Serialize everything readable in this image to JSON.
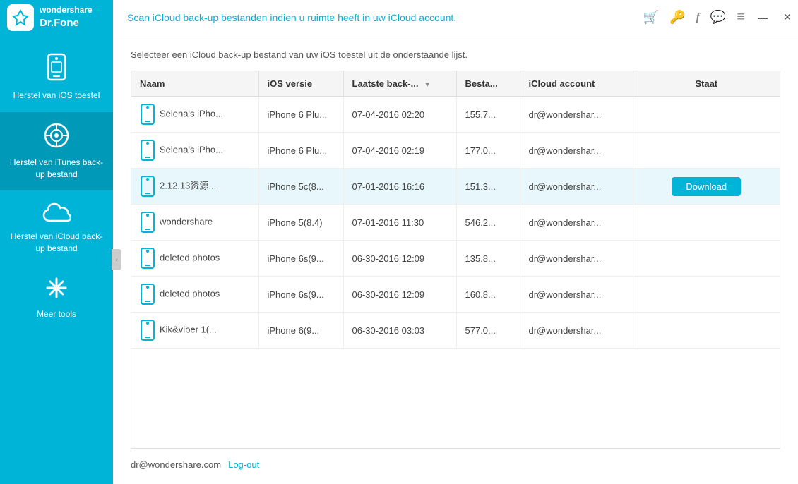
{
  "app": {
    "logo_line1": "wondershare",
    "logo_line2": "Dr.Fone",
    "logo_symbol": "✦"
  },
  "header": {
    "message": "Scan iCloud back-up bestanden indien u ruimte heeft in uw iCloud account.",
    "icons": [
      {
        "name": "cart-icon",
        "symbol": "🛒",
        "color": "#e6a817"
      },
      {
        "name": "gift-icon",
        "symbol": "🔑",
        "color": "#e6a817"
      },
      {
        "name": "facebook-icon",
        "symbol": "f",
        "color": "#888"
      },
      {
        "name": "chat-icon",
        "symbol": "💬",
        "color": "#888"
      },
      {
        "name": "menu-icon",
        "symbol": "≡",
        "color": "#888"
      }
    ],
    "window_controls": {
      "minimize": "—",
      "close": "✕"
    }
  },
  "sidebar": {
    "items": [
      {
        "id": "ios-restore",
        "icon": "📱",
        "label": "Herstel van iOS toestel"
      },
      {
        "id": "itunes-restore",
        "icon": "🎵",
        "label": "Herstel van iTunes back-up bestand",
        "active": true
      },
      {
        "id": "icloud-restore",
        "icon": "☁",
        "label": "Herstel van iCloud back-up bestand"
      },
      {
        "id": "more-tools",
        "icon": "🔧",
        "label": "Meer tools"
      }
    ],
    "toggle_char": "‹"
  },
  "content": {
    "subtitle": "Selecteer een iCloud back-up bestand van uw iOS toestel uit de onderstaande lijst.",
    "table": {
      "columns": [
        {
          "id": "name",
          "label": "Naam",
          "sortable": false
        },
        {
          "id": "ios",
          "label": "iOS versie",
          "sortable": false
        },
        {
          "id": "backup",
          "label": "Laatste back-...",
          "sortable": true
        },
        {
          "id": "size",
          "label": "Besta...",
          "sortable": false
        },
        {
          "id": "account",
          "label": "iCloud account",
          "sortable": false
        },
        {
          "id": "state",
          "label": "Staat",
          "sortable": false
        }
      ],
      "rows": [
        {
          "id": 1,
          "name": "Selena's iPho...",
          "ios": "iPhone 6 Plu...",
          "backup": "07-04-2016 02:20",
          "size": "155.7...",
          "account": "dr@wondershar...",
          "state": "",
          "selected": false
        },
        {
          "id": 2,
          "name": "Selena's iPho...",
          "ios": "iPhone 6 Plu...",
          "backup": "07-04-2016 02:19",
          "size": "177.0...",
          "account": "dr@wondershar...",
          "state": "",
          "selected": false
        },
        {
          "id": 3,
          "name": "2.12.13资源...",
          "ios": "iPhone 5c(8...",
          "backup": "07-01-2016 16:16",
          "size": "151.3...",
          "account": "dr@wondershar...",
          "state": "Download",
          "selected": true
        },
        {
          "id": 4,
          "name": "wondershare",
          "ios": "iPhone 5(8.4)",
          "backup": "07-01-2016 11:30",
          "size": "546.2...",
          "account": "dr@wondershar...",
          "state": "",
          "selected": false
        },
        {
          "id": 5,
          "name": "deleted photos",
          "ios": "iPhone 6s(9...",
          "backup": "06-30-2016 12:09",
          "size": "135.8...",
          "account": "dr@wondershar...",
          "state": "",
          "selected": false
        },
        {
          "id": 6,
          "name": "deleted photos",
          "ios": "iPhone 6s(9...",
          "backup": "06-30-2016 12:09",
          "size": "160.8...",
          "account": "dr@wondershar...",
          "state": "",
          "selected": false
        },
        {
          "id": 7,
          "name": "Kik&viber 1(...",
          "ios": "iPhone 6(9...",
          "backup": "06-30-2016 03:03",
          "size": "577.0...",
          "account": "dr@wondershar...",
          "state": "",
          "selected": false
        }
      ]
    },
    "footer": {
      "email": "dr@wondershare.com",
      "logout_label": "Log-out"
    }
  }
}
